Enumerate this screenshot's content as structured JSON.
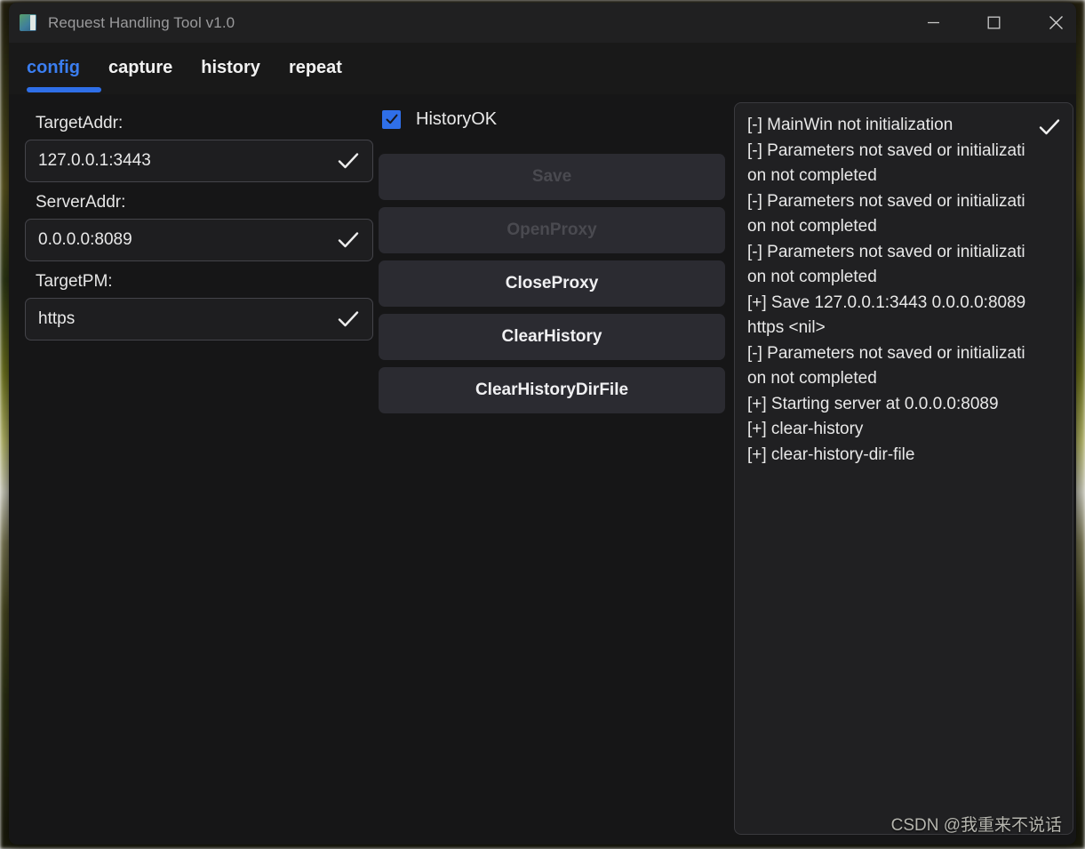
{
  "window": {
    "title": "Request Handling Tool v1.0",
    "app_icon": "app-window-icon",
    "controls": {
      "minimize": "minimize-icon",
      "maximize": "maximize-icon",
      "close": "close-icon"
    }
  },
  "tabs": [
    {
      "label": "config",
      "active": true
    },
    {
      "label": "capture",
      "active": false
    },
    {
      "label": "history",
      "active": false
    },
    {
      "label": "repeat",
      "active": false
    }
  ],
  "form": {
    "fields": [
      {
        "label": "TargetAddr:",
        "value": "127.0.0.1:3443",
        "valid_icon": "check-icon"
      },
      {
        "label": "ServerAddr:",
        "value": "0.0.0.0:8089",
        "valid_icon": "check-icon"
      },
      {
        "label": "TargetPM:",
        "value": "https",
        "valid_icon": "check-icon"
      }
    ]
  },
  "options": {
    "history_ok": {
      "label": "HistoryOK",
      "checked": true
    }
  },
  "actions": [
    {
      "label": "Save",
      "enabled": false
    },
    {
      "label": "OpenProxy",
      "enabled": false
    },
    {
      "label": "CloseProxy",
      "enabled": true
    },
    {
      "label": "ClearHistory",
      "enabled": true
    },
    {
      "label": "ClearHistoryDirFile",
      "enabled": true
    }
  ],
  "log": {
    "corner_icon": "check-icon",
    "lines": [
      "[-] MainWin not initialization",
      "[-] Parameters not saved or initialization not completed",
      "[-] Parameters not saved or initialization not completed",
      "[-] Parameters not saved or initialization not completed",
      "[+] Save 127.0.0.1:3443 0.0.0.0:8089 https <nil>",
      "[-] Parameters not saved or initialization not completed",
      "[+] Starting server at 0.0.0.0:8089",
      "[+] clear-history",
      "[+] clear-history-dir-file"
    ]
  },
  "watermark": "CSDN @我重来不说话",
  "colors": {
    "accent": "#2f6fe8",
    "tab_active": "#3b7ef0",
    "window_bg": "#161617",
    "titlebar_bg": "#202021",
    "button_bg": "#2b2b31",
    "button_disabled_text": "#4a4a50",
    "log_bg": "#202022"
  }
}
